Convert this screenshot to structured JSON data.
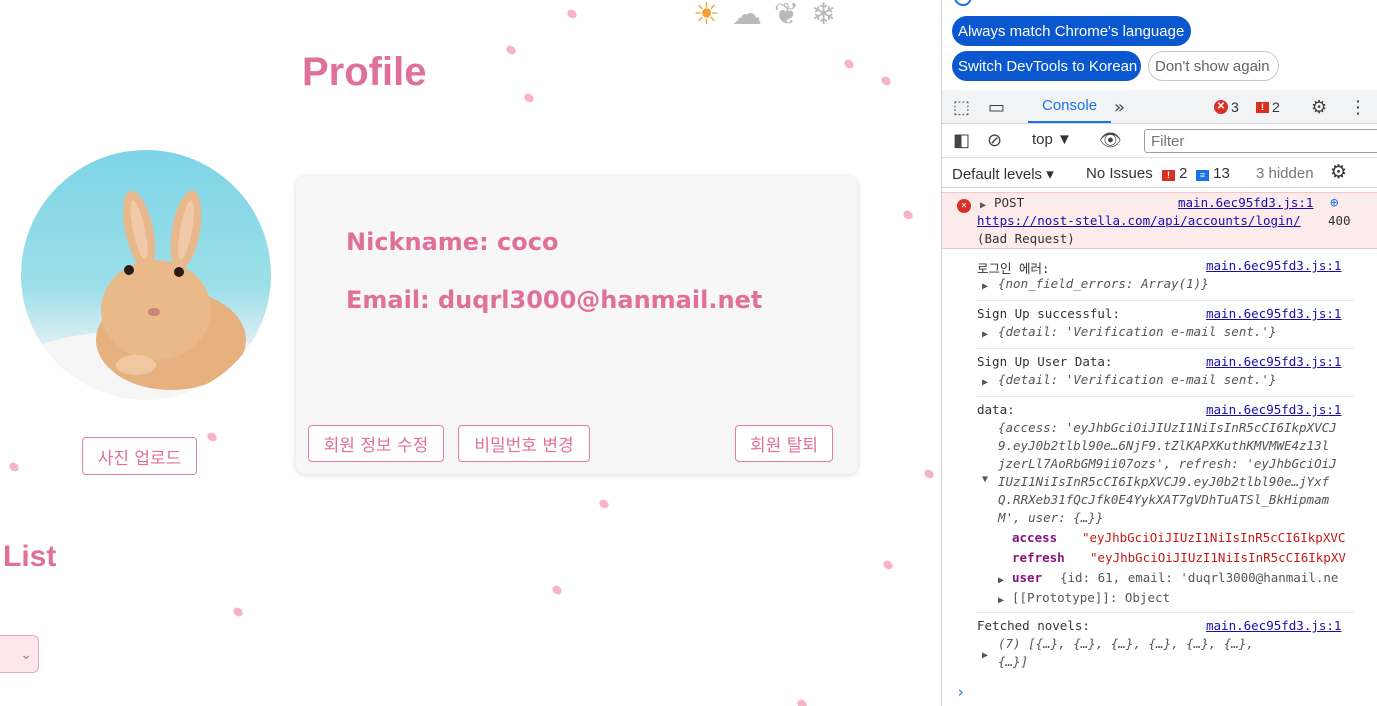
{
  "page": {
    "title": "Profile",
    "weather_icons": [
      "sun-icon",
      "rain-cloud-icon",
      "leaf-icon",
      "snowflake-icon"
    ],
    "profile": {
      "nickname_label": "Nickname: coco",
      "email_label": "Email: duqrl3000@hanmail.net"
    },
    "buttons": {
      "upload_photo": "사진 업로드",
      "edit_info": "회원 정보 수정",
      "change_password": "비밀번호 변경",
      "withdraw": "회원 탈퇴"
    },
    "list_title": "List",
    "colors": {
      "accent": "#e0709a",
      "petal": "#f7b4c6"
    }
  },
  "devtools": {
    "language_prompt": {
      "always_match": "Always match Chrome's language",
      "switch_korean": "Switch DevTools to Korean",
      "dont_show": "Don't show again"
    },
    "tabs": {
      "console": "Console",
      "error_count": "3",
      "warning_count": "2"
    },
    "toolbar": {
      "context": "top",
      "filter_placeholder": "Filter",
      "levels": "Default levels",
      "no_issues": "No Issues",
      "issues_warning_count": "2",
      "issues_info_count": "13",
      "hidden": "3 hidden"
    },
    "messages": {
      "error": {
        "method": "POST",
        "url": "https://nost-stella.com/api/accounts/login/",
        "status": "400",
        "status_text": "(Bad Request)",
        "source": "main.6ec95fd3.js:1"
      },
      "login_error": {
        "label": "로그인 에러:",
        "detail": "{non_field_errors: Array(1)}",
        "source": "main.6ec95fd3.js:1"
      },
      "signup_success": {
        "label": "Sign Up successful:",
        "detail": "{detail: 'Verification e-mail sent.'}",
        "source": "main.6ec95fd3.js:1"
      },
      "signup_data": {
        "label": "Sign Up User Data:",
        "detail": "{detail: 'Verification e-mail sent.'}",
        "source": "main.6ec95fd3.js:1"
      },
      "data": {
        "label": "data:",
        "source": "main.6ec95fd3.js:1",
        "preview_1": "{access: 'eyJhbGciOiJIUzI1NiIsInR5cCI6IkpXVCJ",
        "preview_2": "9.eyJ0b2tlbl90e…6NjF9.tZlKAPXKuthKMVMWE4z13l",
        "preview_3": "jzerLl7AoRbGM9ii07ozs', refresh: 'eyJhbGciOiJ",
        "preview_4": "IUzI1NiIsInR5cCI6IkpXVCJ9.eyJ0b2tlbl90e…jYxf",
        "preview_5": "Q.RRXeb31fQcJfk0E4YykXAT7gVDhTuATSl_BkHipmam",
        "preview_6": "M', user: {…}}",
        "access_key": "access",
        "access_value": "\"eyJhbGciOiJIUzI1NiIsInR5cCI6IkpXVC",
        "refresh_key": "refresh",
        "refresh_value": "\"eyJhbGciOiJIUzI1NiIsInR5cCI6IkpXV",
        "user_key": "user",
        "user_value": "{id: 61, email: 'duqrl3000@hanmail.ne",
        "prototype": "[[Prototype]]: Object"
      },
      "novels": {
        "label": "Fetched novels:",
        "detail_1": "(7) [{…}, {…}, {…}, {…}, {…}, {…},",
        "detail_2": "{…}]",
        "source": "main.6ec95fd3.js:1"
      }
    }
  }
}
